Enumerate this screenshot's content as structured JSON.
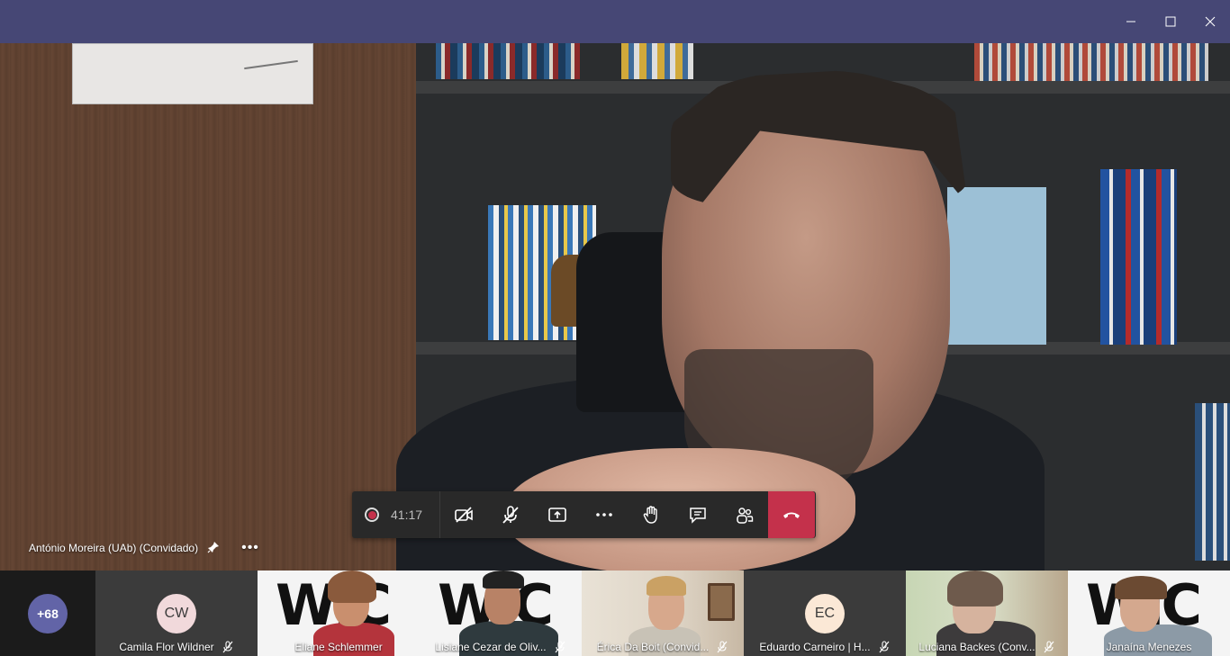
{
  "window": {
    "controls": [
      "minimize",
      "maximize",
      "close"
    ]
  },
  "call": {
    "timer": "41:17",
    "recording": true,
    "controls": [
      "camera-off",
      "mic-off",
      "share-screen",
      "more-actions",
      "raise-hand",
      "chat",
      "participants",
      "hang-up"
    ]
  },
  "presenter": {
    "name": "António Moreira (UAb) (Convidado)"
  },
  "gallery": {
    "overflow_count": "+68",
    "participants": [
      {
        "name": "Camila Flor Wildner",
        "initials": "CW",
        "avatar_color": "#f1d9db",
        "video": false,
        "muted": true
      },
      {
        "name": "Eliane Schlemmer",
        "video": true,
        "muted": false
      },
      {
        "name": "Lisiane Cezar de Oliv...",
        "video": true,
        "muted": true
      },
      {
        "name": "Érica Da Boit (Convid...",
        "video": true,
        "muted": true
      },
      {
        "name": "Eduardo Carneiro | H...",
        "initials": "EC",
        "avatar_color": "#fbe8d6",
        "video": false,
        "muted": true
      },
      {
        "name": "Luciana Backes (Conv...",
        "video": true,
        "muted": true
      },
      {
        "name": "Janaína Menezes",
        "video": true,
        "muted": false
      }
    ]
  },
  "colors": {
    "titlebar": "#464775",
    "hangup": "#c4314b",
    "overflow_badge": "#6264a7"
  }
}
